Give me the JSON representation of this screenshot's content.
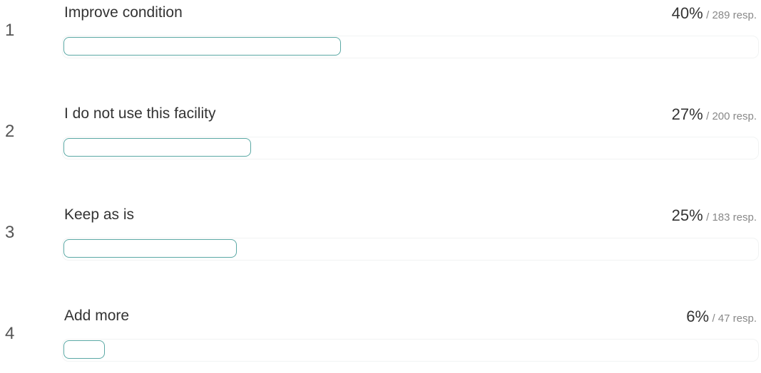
{
  "chart_data": {
    "type": "bar",
    "orientation": "horizontal",
    "rows": [
      {
        "rank": "1",
        "label": "Improve condition",
        "percent": "40%",
        "responses": "/ 289 resp.",
        "value": 40,
        "count": 289
      },
      {
        "rank": "2",
        "label": "I do not use this facility",
        "percent": "27%",
        "responses": "/ 200 resp.",
        "value": 27,
        "count": 200
      },
      {
        "rank": "3",
        "label": "Keep as is",
        "percent": "25%",
        "responses": "/ 183 resp.",
        "value": 25,
        "count": 183
      },
      {
        "rank": "4",
        "label": "Add more",
        "percent": "6%",
        "responses": "/ 47 resp.",
        "value": 6,
        "count": 47
      }
    ],
    "xlim": [
      0,
      100
    ],
    "bar_outline_color": "#5aa8a4",
    "track_color": "#f1f3f3"
  }
}
